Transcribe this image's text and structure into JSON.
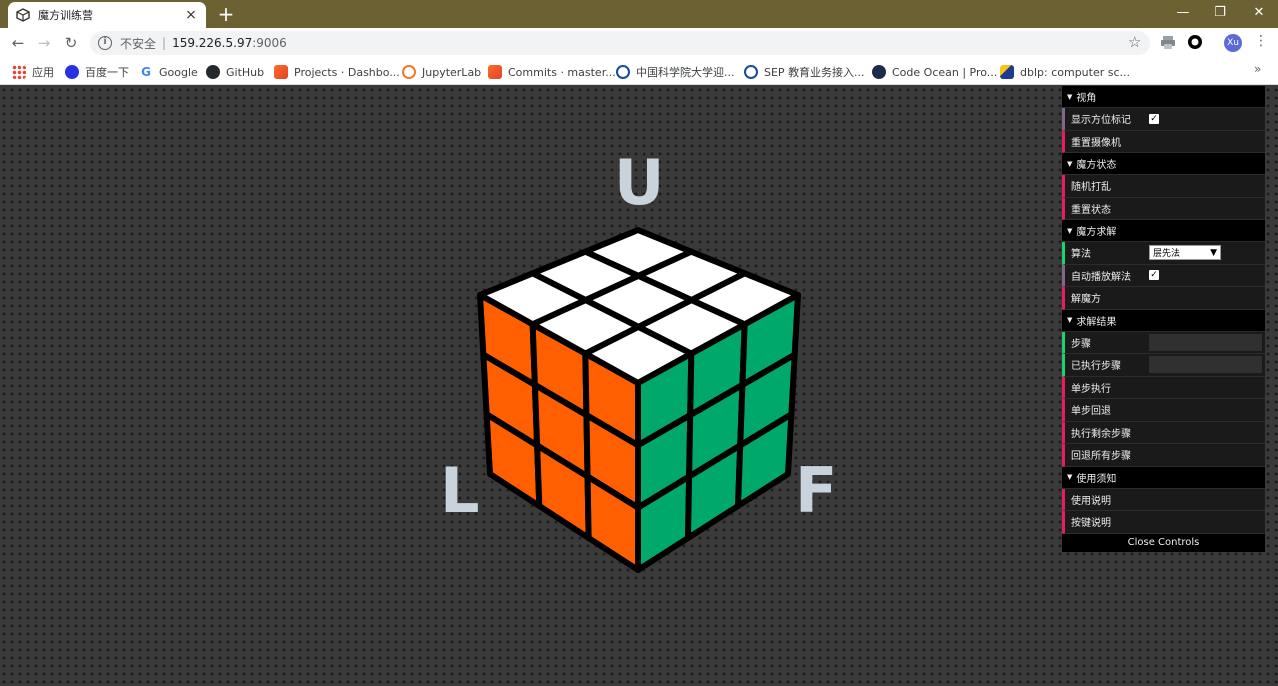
{
  "browser": {
    "tab_title": "魔方训练营",
    "tab_close": "×",
    "new_tab": "+",
    "window_controls": {
      "minimize": "—",
      "restore": "❐",
      "close": "✕"
    },
    "nav": {
      "back": "←",
      "forward": "→",
      "reload": "↻"
    },
    "address": {
      "insecure_label": "不安全",
      "separator": "|",
      "host": "159.226.5.97",
      "port": ":9006"
    },
    "avatar_text": "Xu",
    "bookmarks": [
      {
        "label": "应用",
        "icon": "apps-grid-icon",
        "color": "#4285f4"
      },
      {
        "label": "百度一下",
        "icon": "baidu-icon",
        "color": "#2932e1"
      },
      {
        "label": "Google",
        "icon": "google-icon",
        "color": "#ea4335"
      },
      {
        "label": "GitHub",
        "icon": "github-icon",
        "color": "#24292e"
      },
      {
        "label": "Projects · Dashbo...",
        "icon": "gitlab-icon",
        "color": "#e24329"
      },
      {
        "label": "JupyterLab",
        "icon": "jupyter-icon",
        "color": "#f37726"
      },
      {
        "label": "Commits · master...",
        "icon": "gitlab-icon",
        "color": "#e24329"
      },
      {
        "label": "中国科学院大学迎...",
        "icon": "ucas-icon",
        "color": "#1a4a9c"
      },
      {
        "label": "SEP 教育业务接入...",
        "icon": "sep-icon",
        "color": "#1a4a9c"
      },
      {
        "label": "Code Ocean | Pro...",
        "icon": "codeocean-icon",
        "color": "#1b2b4a"
      },
      {
        "label": "dblp: computer sc...",
        "icon": "dblp-icon",
        "color": "#1f3b8f"
      }
    ],
    "bookmarks_more": "»"
  },
  "scene": {
    "labels": {
      "up": "U",
      "left": "L",
      "front": "F"
    },
    "colors": {
      "top": "#ffffff",
      "left": "#ff5f00",
      "right": "#00a86b",
      "edge": "#000000"
    }
  },
  "controls": {
    "folders": {
      "view": "视角",
      "state": "魔方状态",
      "solve": "魔方求解",
      "result": "求解结果",
      "help": "使用须知"
    },
    "show_markers_label": "显示方位标记",
    "show_markers_checked": "✓",
    "reset_camera": "重置摄像机",
    "random_scramble": "随机打乱",
    "reset_state": "重置状态",
    "algorithm_label": "算法",
    "algorithm_value": "层先法",
    "algorithm_arrow": "▼",
    "autoplay_label": "自动播放解法",
    "autoplay_checked": "✓",
    "solve_button": "解魔方",
    "steps_label": "步骤",
    "steps_value": "",
    "executed_label": "已执行步骤",
    "executed_value": "",
    "step_forward": "单步执行",
    "step_back": "单步回退",
    "run_rest": "执行剩余步骤",
    "undo_all": "回退所有步骤",
    "usage_guide": "使用说明",
    "keys_guide": "按键说明",
    "close_controls": "Close Controls",
    "folder_arrow": "▼"
  }
}
